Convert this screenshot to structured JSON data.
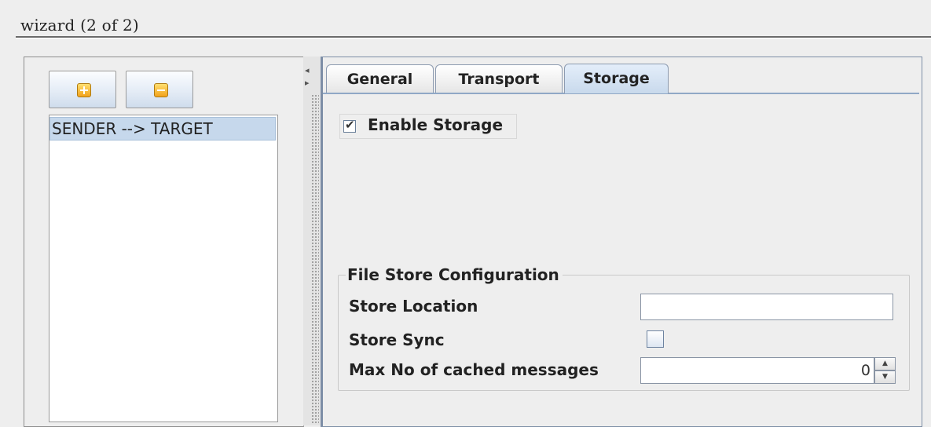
{
  "window": {
    "title": "wizard (2 of 2)"
  },
  "toolbar": {
    "add_icon": "plus-icon",
    "remove_icon": "minus-icon"
  },
  "list": {
    "items": [
      "SENDER --> TARGET"
    ]
  },
  "splitter": {
    "left_arrow": "◂",
    "right_arrow": "▸"
  },
  "tabs": [
    {
      "label": "General",
      "selected": false
    },
    {
      "label": "Transport",
      "selected": false
    },
    {
      "label": "Storage",
      "selected": true
    }
  ],
  "storage": {
    "enable_label": "Enable Storage",
    "enable_checked": true,
    "check_mark": "✔",
    "group_title": "File Store Configuration",
    "store_location_label": "Store Location",
    "store_location_value": "",
    "store_sync_label": "Store Sync",
    "store_sync_checked": false,
    "max_cached_label": "Max No of cached messages",
    "max_cached_value": "0",
    "spin_up": "▲",
    "spin_down": "▼"
  },
  "colors": {
    "selection": "#c6d8ec",
    "tab_border": "#7d8ea6",
    "background": "#eeeeee"
  }
}
